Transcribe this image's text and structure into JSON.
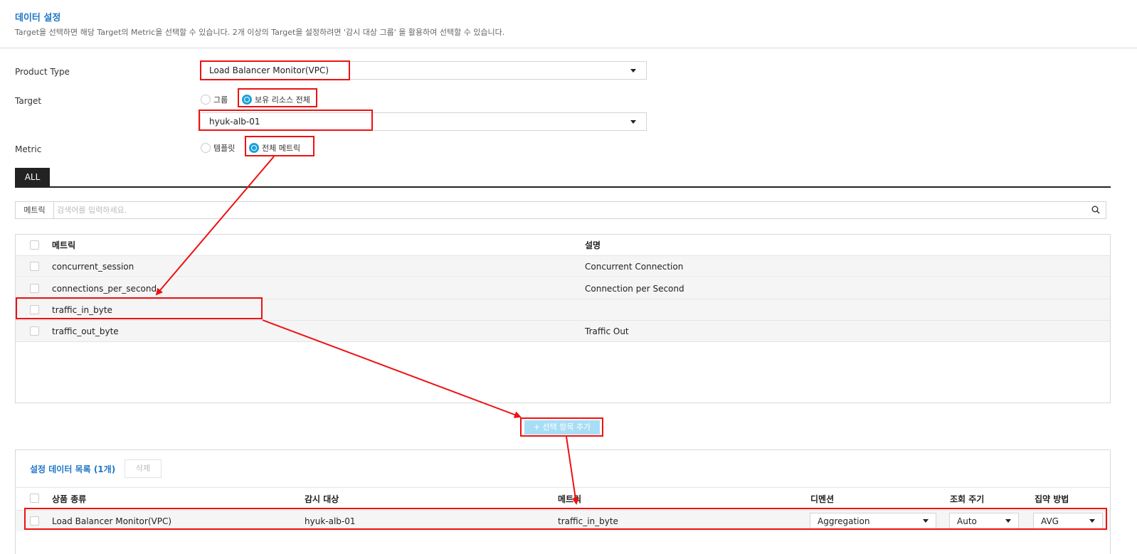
{
  "section": {
    "title": "데이터 설정",
    "desc": "Target을 선택하면 해당 Target의 Metric을 선택할 수 있습니다. 2개 이상의 Target을 설정하려면 '감시 대상 그룹' 을 활용하여 선택할 수 있습니다."
  },
  "form": {
    "product_type_label": "Product Type",
    "product_type_value": "Load Balancer Monitor(VPC)",
    "target_label": "Target",
    "target_radio_group": "그룹",
    "target_radio_all": "보유 리소스 전체",
    "target_value": "hyuk-alb-01",
    "metric_label": "Metric",
    "metric_radio_template": "템플릿",
    "metric_radio_all": "전체 메트릭"
  },
  "tabs": {
    "all": "ALL"
  },
  "search": {
    "label": "메트릭",
    "placeholder": "검색어를 입력하세요."
  },
  "metric_table": {
    "headers": {
      "metric": "메트릭",
      "desc": "설명"
    },
    "rows": [
      {
        "metric": "concurrent_session",
        "desc": "Concurrent Connection"
      },
      {
        "metric": "connections_per_second",
        "desc": "Connection per Second"
      },
      {
        "metric": "traffic_in_byte",
        "desc": ""
      },
      {
        "metric": "traffic_out_byte",
        "desc": "Traffic Out"
      }
    ]
  },
  "add_button": "+ 선택 항목 추가",
  "data_list": {
    "title": "설정 데이터 목록 (1개)",
    "delete_button": "삭제",
    "headers": {
      "product": "상품 종류",
      "target": "감시 대상",
      "metric": "메트릭",
      "dimension": "디멘션",
      "interval": "조회 주기",
      "aggregation": "집약 방법"
    },
    "row": {
      "product": "Load Balancer Monitor(VPC)",
      "target": "hyuk-alb-01",
      "metric": "traffic_in_byte",
      "dimension": "Aggregation",
      "interval": "Auto",
      "aggregation": "AVG"
    }
  },
  "colors": {
    "accent": "#1e76c9",
    "highlight": "#ee1111",
    "radio_on": "#1aa1dc",
    "add_button_bg": "#a8def5"
  }
}
